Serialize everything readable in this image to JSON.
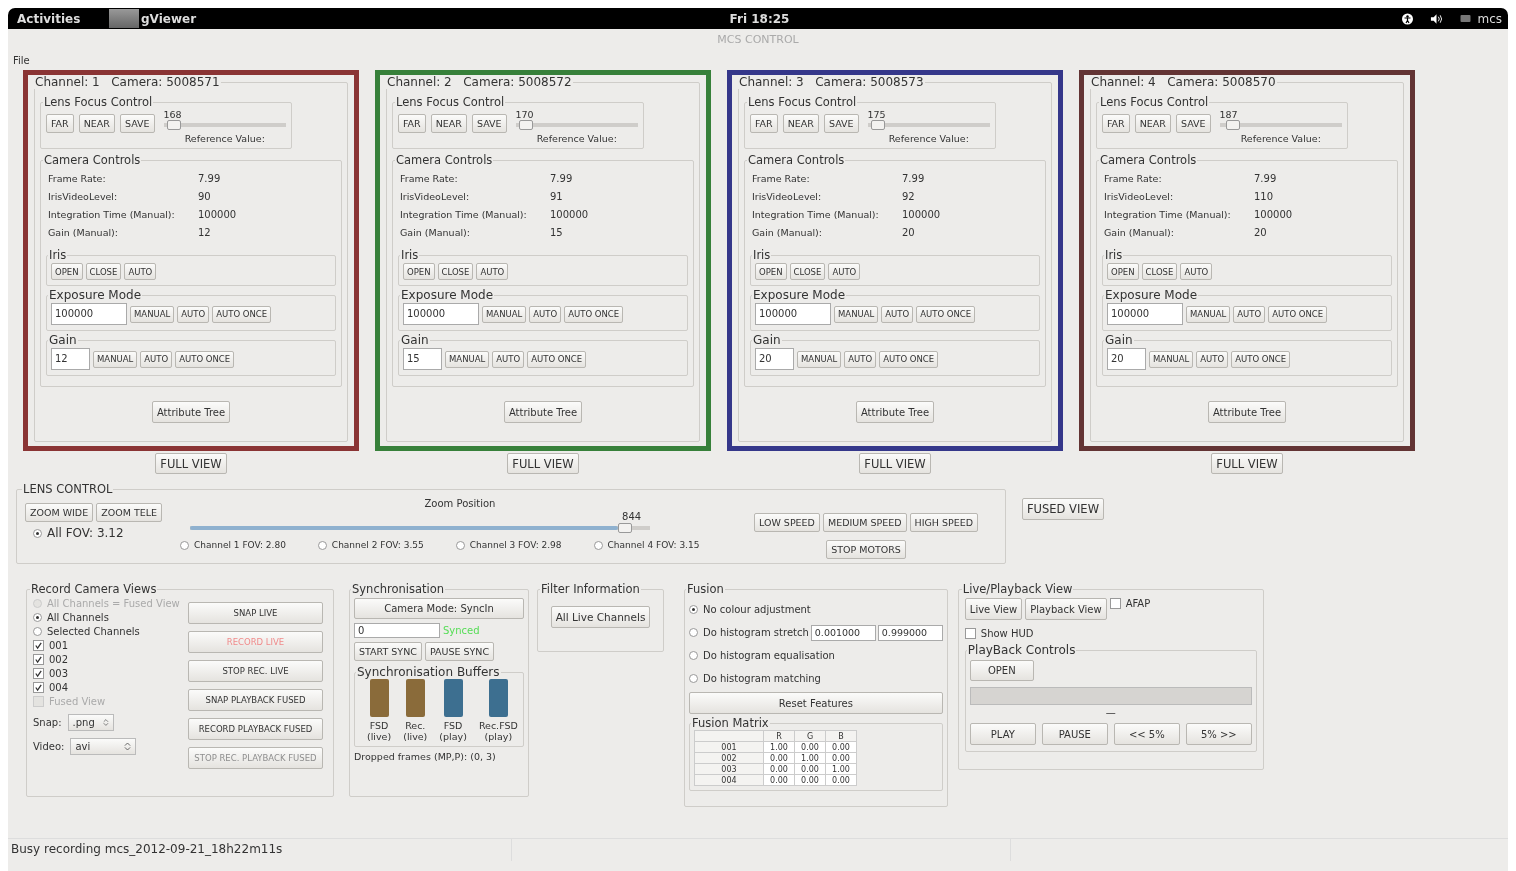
{
  "topbar": {
    "activities": "Activities",
    "app": "gViewer",
    "clock": "Fri 18:25",
    "user": "mcs"
  },
  "window": {
    "title": "MCS CONTROL"
  },
  "menu": [
    "File"
  ],
  "channels": [
    {
      "channel": "Channel: 1",
      "camera": "Camera: 5008571",
      "color": "#8a3434",
      "focus": {
        "title": "Lens Focus Control",
        "buttons": [
          "FAR",
          "NEAR",
          "SAVE"
        ],
        "value": "168",
        "level": 0.03,
        "reference": "Reference Value:"
      },
      "controls": {
        "title": "Camera Controls",
        "rows": [
          {
            "label": "Frame Rate:",
            "value": "7.99"
          },
          {
            "label": "IrisVideoLevel:",
            "value": "90"
          },
          {
            "label": "Integration Time (Manual):",
            "value": "100000"
          },
          {
            "label": "Gain (Manual):",
            "value": "12"
          }
        ],
        "iris": {
          "title": "Iris",
          "buttons": [
            "OPEN",
            "CLOSE",
            "AUTO"
          ]
        },
        "exposure": {
          "title": "Exposure Mode",
          "value": "100000",
          "buttons": [
            "MANUAL",
            "AUTO",
            "AUTO ONCE"
          ]
        },
        "gain": {
          "title": "Gain",
          "value": "12",
          "buttons": [
            "MANUAL",
            "AUTO",
            "AUTO ONCE"
          ]
        }
      },
      "attribute_button": "Attribute Tree",
      "full_view": "FULL VIEW"
    },
    {
      "channel": "Channel: 2",
      "camera": "Camera: 5008572",
      "color": "#37803a",
      "focus": {
        "title": "Lens Focus Control",
        "buttons": [
          "FAR",
          "NEAR",
          "SAVE"
        ],
        "value": "170",
        "level": 0.03,
        "reference": "Reference Value:"
      },
      "controls": {
        "title": "Camera Controls",
        "rows": [
          {
            "label": "Frame Rate:",
            "value": "7.99"
          },
          {
            "label": "IrisVideoLevel:",
            "value": "91"
          },
          {
            "label": "Integration Time (Manual):",
            "value": "100000"
          },
          {
            "label": "Gain (Manual):",
            "value": "15"
          }
        ],
        "iris": {
          "title": "Iris",
          "buttons": [
            "OPEN",
            "CLOSE",
            "AUTO"
          ]
        },
        "exposure": {
          "title": "Exposure Mode",
          "value": "100000",
          "buttons": [
            "MANUAL",
            "AUTO",
            "AUTO ONCE"
          ]
        },
        "gain": {
          "title": "Gain",
          "value": "15",
          "buttons": [
            "MANUAL",
            "AUTO",
            "AUTO ONCE"
          ]
        }
      },
      "attribute_button": "Attribute Tree",
      "full_view": "FULL VIEW"
    },
    {
      "channel": "Channel: 3",
      "camera": "Camera: 5008573",
      "color": "#35378a",
      "focus": {
        "title": "Lens Focus Control",
        "buttons": [
          "FAR",
          "NEAR",
          "SAVE"
        ],
        "value": "175",
        "level": 0.03,
        "reference": "Reference Value:"
      },
      "controls": {
        "title": "Camera Controls",
        "rows": [
          {
            "label": "Frame Rate:",
            "value": "7.99"
          },
          {
            "label": "IrisVideoLevel:",
            "value": "92"
          },
          {
            "label": "Integration Time (Manual):",
            "value": "100000"
          },
          {
            "label": "Gain (Manual):",
            "value": "20"
          }
        ],
        "iris": {
          "title": "Iris",
          "buttons": [
            "OPEN",
            "CLOSE",
            "AUTO"
          ]
        },
        "exposure": {
          "title": "Exposure Mode",
          "value": "100000",
          "buttons": [
            "MANUAL",
            "AUTO",
            "AUTO ONCE"
          ]
        },
        "gain": {
          "title": "Gain",
          "value": "20",
          "buttons": [
            "MANUAL",
            "AUTO",
            "AUTO ONCE"
          ]
        }
      },
      "attribute_button": "Attribute Tree",
      "full_view": "FULL VIEW"
    },
    {
      "channel": "Channel: 4",
      "camera": "Camera: 5008570",
      "color": "#633434",
      "focus": {
        "title": "Lens Focus Control",
        "buttons": [
          "FAR",
          "NEAR",
          "SAVE"
        ],
        "value": "187",
        "level": 0.06,
        "reference": "Reference Value:"
      },
      "controls": {
        "title": "Camera Controls",
        "rows": [
          {
            "label": "Frame Rate:",
            "value": "7.99"
          },
          {
            "label": "IrisVideoLevel:",
            "value": "110"
          },
          {
            "label": "Integration Time (Manual):",
            "value": "100000"
          },
          {
            "label": "Gain (Manual):",
            "value": "20"
          }
        ],
        "iris": {
          "title": "Iris",
          "buttons": [
            "OPEN",
            "CLOSE",
            "AUTO"
          ]
        },
        "exposure": {
          "title": "Exposure Mode",
          "value": "100000",
          "buttons": [
            "MANUAL",
            "AUTO",
            "AUTO ONCE"
          ]
        },
        "gain": {
          "title": "Gain",
          "value": "20",
          "buttons": [
            "MANUAL",
            "AUTO",
            "AUTO ONCE"
          ]
        }
      },
      "attribute_button": "Attribute Tree",
      "full_view": "FULL VIEW"
    }
  ],
  "lens_control": {
    "title": "LENS CONTROL",
    "zoom_buttons": [
      "ZOOM WIDE",
      "ZOOM TELE"
    ],
    "all_fov": {
      "label": "All FOV: 3.12",
      "selected": true
    },
    "zoom": {
      "label": "Zoom Position",
      "value": "844",
      "level": 0.96
    },
    "channel_fovs": [
      {
        "label": "Channel 1 FOV: 2.80",
        "selected": false
      },
      {
        "label": "Channel 2 FOV: 3.55",
        "selected": false
      },
      {
        "label": "Channel 3 FOV: 2.98",
        "selected": false
      },
      {
        "label": "Channel 4 FOV: 3.15",
        "selected": false
      }
    ],
    "speed_buttons": [
      "LOW SPEED",
      "MEDIUM SPEED",
      "HIGH SPEED"
    ],
    "stop_button": "STOP MOTORS"
  },
  "fused_view_button": "FUSED VIEW",
  "record": {
    "title": "Record Camera Views",
    "radios": [
      {
        "label": "All Channels = Fused View",
        "selected": false,
        "disabled": true
      },
      {
        "label": "All Channels",
        "selected": true,
        "disabled": false
      },
      {
        "label": "Selected Channels",
        "selected": false,
        "disabled": false
      }
    ],
    "checkboxes": [
      {
        "label": "001",
        "checked": true,
        "disabled": false
      },
      {
        "label": "002",
        "checked": true,
        "disabled": false
      },
      {
        "label": "003",
        "checked": true,
        "disabled": false
      },
      {
        "label": "004",
        "checked": true,
        "disabled": false
      },
      {
        "label": "Fused View",
        "checked": false,
        "disabled": true
      }
    ],
    "buttons": [
      {
        "label": "SNAP LIVE",
        "active": false,
        "disabled": false
      },
      {
        "label": "RECORD LIVE",
        "active": true,
        "disabled": false
      },
      {
        "label": "STOP REC. LIVE",
        "active": false,
        "disabled": false
      },
      {
        "label": "SNAP PLAYBACK FUSED",
        "active": false,
        "disabled": false
      },
      {
        "label": "RECORD PLAYBACK FUSED",
        "active": false,
        "disabled": false
      },
      {
        "label": "STOP REC. PLAYBACK FUSED",
        "active": false,
        "disabled": true
      }
    ],
    "snap": {
      "label": "Snap:",
      "value": ".png"
    },
    "video": {
      "label": "Video:",
      "value": "avi"
    }
  },
  "sync": {
    "title": "Synchronisation",
    "mode_button": "Camera Mode: SyncIn",
    "field": "0",
    "status": "Synced",
    "buttons": [
      "START SYNC",
      "PAUSE SYNC"
    ],
    "buffers": {
      "title": "Synchronisation Buffers",
      "items": [
        {
          "name": "FSD",
          "mode": "(live)",
          "color": "#8a6b3a"
        },
        {
          "name": "Rec.",
          "mode": "(live)",
          "color": "#8a6b3a"
        },
        {
          "name": "FSD",
          "mode": "(play)",
          "color": "#3d6f90"
        },
        {
          "name": "Rec.FSD",
          "mode": "(play)",
          "color": "#3d6f90"
        }
      ]
    },
    "dropped": "Dropped frames (MP,P): (0, 3)"
  },
  "filter": {
    "title": "Filter Information",
    "button": "All Live Channels"
  },
  "fusion": {
    "title": "Fusion",
    "options": [
      {
        "label": "No colour adjustment",
        "selected": true
      },
      {
        "label": "Do histogram stretch",
        "selected": false
      },
      {
        "label": "Do histogram equalisation",
        "selected": false
      },
      {
        "label": "Do histogram matching",
        "selected": false
      }
    ],
    "stretch_fields": [
      "0.001000",
      "0.999000"
    ],
    "reset_button": "Reset Features",
    "matrix": {
      "title": "Fusion Matrix",
      "columns": [
        "R",
        "G",
        "B"
      ],
      "rows": [
        {
          "name": "001",
          "values": [
            "1.00",
            "0.00",
            "0.00"
          ]
        },
        {
          "name": "002",
          "values": [
            "0.00",
            "1.00",
            "0.00"
          ]
        },
        {
          "name": "003",
          "values": [
            "0.00",
            "0.00",
            "1.00"
          ]
        },
        {
          "name": "004",
          "values": [
            "0.00",
            "0.00",
            "0.00"
          ]
        }
      ]
    }
  },
  "live_playback": {
    "title": "Live/Playback View",
    "buttons": [
      "Live View",
      "Playback View"
    ],
    "afap": {
      "label": "AFAP",
      "checked": false
    },
    "show_hud": {
      "label": "Show HUD",
      "checked": false
    },
    "playback": {
      "title": "PlayBack Controls",
      "open_button": "OPEN",
      "position": "—",
      "controls": [
        "PLAY",
        "PAUSE",
        "<< 5%",
        "5% >>"
      ]
    }
  },
  "status_bar": "Busy recording mcs_2012-09-21_18h22m11s"
}
